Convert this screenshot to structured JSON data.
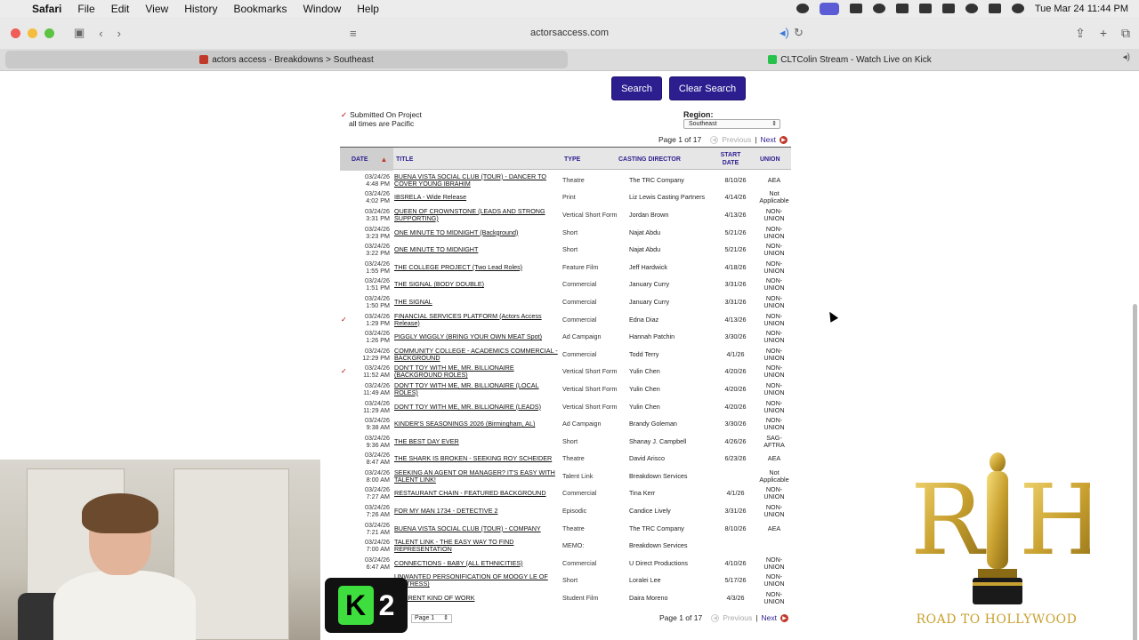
{
  "menubar": {
    "apple": "",
    "app": "Safari",
    "items": [
      "File",
      "Edit",
      "View",
      "History",
      "Bookmarks",
      "Window",
      "Help"
    ],
    "clock": "Tue Mar 24  11:44 PM"
  },
  "browser": {
    "url": "actorsaccess.com",
    "tabs": [
      {
        "label": "actors access - Breakdowns > Southeast",
        "active": true
      },
      {
        "label": "CLTColin Stream - Watch Live on Kick",
        "active": false
      }
    ]
  },
  "search": {
    "search_label": "Search",
    "clear_label": "Clear Search"
  },
  "legend": {
    "submitted": "Submitted On Project",
    "timezone": "all times are Pacific"
  },
  "region": {
    "label": "Region:",
    "value": "Southeast"
  },
  "pager": {
    "text": "Page 1 of 17",
    "previous": "Previous",
    "next": "Next",
    "separator": "|",
    "select_value": "Page 1"
  },
  "table": {
    "headers": {
      "date": "DATE",
      "title": "TITLE",
      "type": "TYPE",
      "casting": "CASTING DIRECTOR",
      "start": "START DATE",
      "union": "UNION"
    },
    "rows": [
      {
        "chk": "",
        "date": "03/24/26 4:48 PM",
        "title": "BUENA VISTA SOCIAL CLUB (TOUR) - DANCER TO COVER YOUNG IBRAHIM",
        "type": "Theatre",
        "cd": "The TRC Company",
        "start": "8/10/26",
        "union": "AEA"
      },
      {
        "chk": "",
        "date": "03/24/26 4:02 PM",
        "title": "IBSRELA - Wide Release",
        "type": "Print",
        "cd": "Liz Lewis Casting Partners",
        "start": "4/14/26",
        "union": "Not Applicable"
      },
      {
        "chk": "",
        "date": "03/24/26 3:31 PM",
        "title": "QUEEN OF CROWNSTONE (LEADS AND STRONG SUPPORTING)",
        "type": "Vertical Short Form",
        "cd": "Jordan Brown",
        "start": "4/13/26",
        "union": "NON-UNION"
      },
      {
        "chk": "",
        "date": "03/24/26 3:23 PM",
        "title": "ONE MINUTE TO MIDNIGHT (Background)",
        "type": "Short",
        "cd": "Najat Abdu",
        "start": "5/21/26",
        "union": "NON-UNION"
      },
      {
        "chk": "",
        "date": "03/24/26 3:22 PM",
        "title": "ONE MINUTE TO MIDNIGHT",
        "type": "Short",
        "cd": "Najat Abdu",
        "start": "5/21/26",
        "union": "NON-UNION"
      },
      {
        "chk": "",
        "date": "03/24/26 1:55 PM",
        "title": "THE COLLEGE PROJECT (Two Lead Roles)",
        "type": "Feature Film",
        "cd": "Jeff Hardwick",
        "start": "4/18/26",
        "union": "NON-UNION"
      },
      {
        "chk": "",
        "date": "03/24/26 1:51 PM",
        "title": "THE SIGNAL (BODY DOUBLE)",
        "type": "Commercial",
        "cd": "January Curry",
        "start": "3/31/26",
        "union": "NON-UNION"
      },
      {
        "chk": "",
        "date": "03/24/26 1:50 PM",
        "title": "THE SIGNAL",
        "type": "Commercial",
        "cd": "January Curry",
        "start": "3/31/26",
        "union": "NON-UNION"
      },
      {
        "chk": "✓",
        "date": "03/24/26 1:29 PM",
        "title": "FINANCIAL SERVICES PLATFORM (Actors Access Release)",
        "type": "Commercial",
        "cd": "Edna Diaz",
        "start": "4/13/26",
        "union": "NON-UNION"
      },
      {
        "chk": "",
        "date": "03/24/26 1:26 PM",
        "title": "PIGGLY WIGGLY (BRING YOUR OWN MEAT Spot)",
        "type": "Ad Campaign",
        "cd": "Hannah Patchin",
        "start": "3/30/26",
        "union": "NON-UNION"
      },
      {
        "chk": "",
        "date": "03/24/26 12:29 PM",
        "title": "COMMUNITY COLLEGE - ACADEMICS COMMERCIAL - BACKGROUND",
        "type": "Commercial",
        "cd": "Todd Terry",
        "start": "4/1/26",
        "union": "NON-UNION"
      },
      {
        "chk": "✓",
        "date": "03/24/26 11:52 AM",
        "title": "DON'T TOY WITH ME, MR. BILLIONAIRE (BACKGROUND ROLES)",
        "type": "Vertical Short Form",
        "cd": "Yulin Chen",
        "start": "4/20/26",
        "union": "NON-UNION"
      },
      {
        "chk": "",
        "date": "03/24/26 11:49 AM",
        "title": "DON'T TOY WITH ME, MR. BILLIONAIRE (LOCAL ROLES)",
        "type": "Vertical Short Form",
        "cd": "Yulin Chen",
        "start": "4/20/26",
        "union": "NON-UNION"
      },
      {
        "chk": "",
        "date": "03/24/26 11:29 AM",
        "title": "DON'T TOY WITH ME, MR. BILLIONAIRE (LEADS)",
        "type": "Vertical Short Form",
        "cd": "Yulin Chen",
        "start": "4/20/26",
        "union": "NON-UNION"
      },
      {
        "chk": "",
        "date": "03/24/26 9:38 AM",
        "title": "KINDER'S SEASONINGS 2026 (Birmingham, AL)",
        "type": "Ad Campaign",
        "cd": "Brandy Goleman",
        "start": "3/30/26",
        "union": "NON-UNION"
      },
      {
        "chk": "",
        "date": "03/24/26 9:36 AM",
        "title": "THE BEST DAY EVER",
        "type": "Short",
        "cd": "Shanay J. Campbell",
        "start": "4/26/26",
        "union": "SAG-AFTRA"
      },
      {
        "chk": "",
        "date": "03/24/26 8:47 AM",
        "title": "THE SHARK IS BROKEN - SEEKING ROY SCHEIDER",
        "type": "Theatre",
        "cd": "David Arisco",
        "start": "6/23/26",
        "union": "AEA"
      },
      {
        "chk": "",
        "date": "03/24/26 8:00 AM",
        "title": "SEEKING AN AGENT OR MANAGER? IT'S EASY WITH TALENT LINK!",
        "type": "Talent Link",
        "cd": "Breakdown Services",
        "start": "",
        "union": "Not Applicable"
      },
      {
        "chk": "",
        "date": "03/24/26 7:27 AM",
        "title": "RESTAURANT CHAIN - FEATURED BACKGROUND",
        "type": "Commercial",
        "cd": "Tina Kerr",
        "start": "4/1/26",
        "union": "NON-UNION"
      },
      {
        "chk": "",
        "date": "03/24/26 7:26 AM",
        "title": "FOR MY MAN 1734 - DETECTIVE 2",
        "type": "Episodic",
        "cd": "Candice Lively",
        "start": "3/31/26",
        "union": "NON-UNION"
      },
      {
        "chk": "",
        "date": "03/24/26 7:21 AM",
        "title": "BUENA VISTA SOCIAL CLUB (TOUR) - COMPANY",
        "type": "Theatre",
        "cd": "The TRC Company",
        "start": "8/10/26",
        "union": "AEA"
      },
      {
        "chk": "",
        "date": "03/24/26 7:00 AM",
        "title": "TALENT LINK - THE EASY WAY TO FIND REPRESENTATION",
        "type": "MEMO:",
        "cd": "Breakdown Services",
        "start": "",
        "union": ""
      },
      {
        "chk": "",
        "date": "03/24/26 6:47 AM",
        "title": "CONNECTIONS - BABY (ALL ETHNICITIES)",
        "type": "Commercial",
        "cd": "U Direct Productions",
        "start": "4/10/26",
        "union": "NON-UNION"
      },
      {
        "chk": "",
        "date": "",
        "title": "UNWANTED PERSONIFICATION OF MOOGY LE OF WAITRESS)",
        "type": "Short",
        "cd": "Loralei Lee",
        "start": "5/17/26",
        "union": "NON-UNION"
      },
      {
        "chk": "",
        "date": "",
        "title": "IFFERENT KIND OF WORK",
        "type": "Student Film",
        "cd": "Daira Moreno",
        "start": "4/3/26",
        "union": "NON-UNION"
      }
    ]
  },
  "overlays": {
    "kick_number": "2",
    "kick_letter": "K",
    "logo_letters": "R H",
    "logo_caption": "ROAD TO HOLLYWOOD"
  },
  "colors": {
    "button": "#2c1e8f",
    "link": "#2c1e8f",
    "accent_red": "#c0392b",
    "kick_green": "#3dde3d",
    "gold": "#c9a130"
  }
}
